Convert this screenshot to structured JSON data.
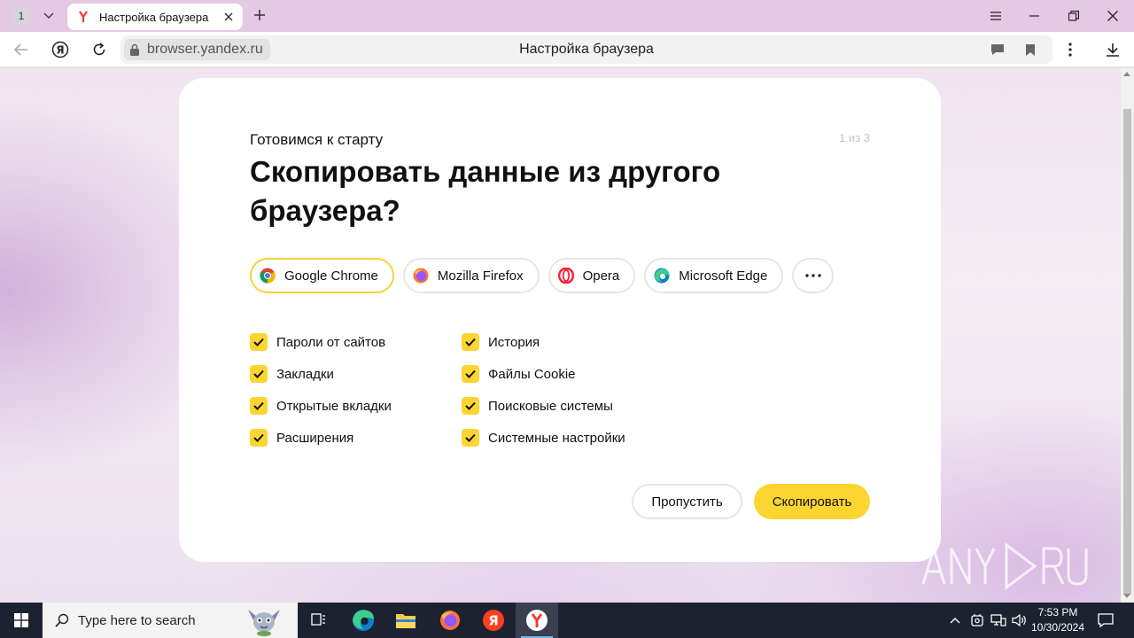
{
  "titlebar": {
    "tab_count": "1",
    "active_tab_title": "Настройка браузера"
  },
  "addressbar": {
    "url": "browser.yandex.ru",
    "page_title": "Настройка браузера"
  },
  "setup": {
    "subtitle": "Готовимся к старту",
    "step": "1 из 3",
    "heading": "Скопировать данные из другого браузера?",
    "browsers": [
      {
        "label": "Google Chrome",
        "selected": true
      },
      {
        "label": "Mozilla Firefox",
        "selected": false
      },
      {
        "label": "Opera",
        "selected": false
      },
      {
        "label": "Microsoft Edge",
        "selected": false
      }
    ],
    "options_left": [
      {
        "label": "Пароли от сайтов",
        "checked": true
      },
      {
        "label": "Закладки",
        "checked": true
      },
      {
        "label": "Открытые вкладки",
        "checked": true
      },
      {
        "label": "Расширения",
        "checked": true
      }
    ],
    "options_right": [
      {
        "label": "История",
        "checked": true
      },
      {
        "label": "Файлы Cookie",
        "checked": true
      },
      {
        "label": "Поисковые системы",
        "checked": true
      },
      {
        "label": "Системные настройки",
        "checked": true
      }
    ],
    "skip_label": "Пропустить",
    "copy_label": "Скопировать"
  },
  "watermark": {
    "text": "ANY RUN"
  },
  "taskbar": {
    "search_placeholder": "Type here to search",
    "time": "7:53 PM",
    "date": "10/30/2024"
  },
  "colors": {
    "accent_yellow": "#fcd531",
    "taskbar": "#1c2230",
    "page_background": "#efe4ef"
  }
}
